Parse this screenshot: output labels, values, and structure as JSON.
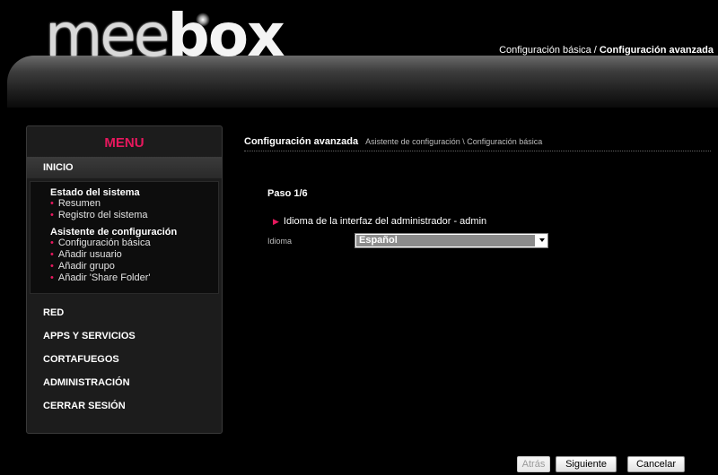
{
  "header": {
    "logo_light": "mee",
    "logo_bold": "box",
    "nav": {
      "basic": "Configuración básica",
      "separator": "/",
      "advanced": "Configuración avanzada"
    }
  },
  "sidebar": {
    "title": "MENU",
    "inicio": "INICIO",
    "groups": [
      {
        "label": "Estado del sistema",
        "links": [
          "Resumen",
          "Registro del sistema"
        ]
      },
      {
        "label": "Asistente de configuración",
        "links": [
          "Configuración básica",
          "Añadir usuario",
          "Añadir grupo",
          "Añadir 'Share Folder'"
        ]
      }
    ],
    "items": [
      "RED",
      "APPS Y SERVICIOS",
      "CORTAFUEGOS",
      "ADMINISTRACIÓN",
      "CERRAR SESIÓN"
    ]
  },
  "content": {
    "title": "Configuración avanzada",
    "breadcrumb": "Asistente de configuración \\ Configuración básica",
    "step": "Paso 1/6",
    "section": "Idioma de la interfaz del administrador - admin",
    "field_label": "Idioma",
    "select_value": "Español"
  },
  "buttons": {
    "back": "Atrás",
    "next": "Siguiente",
    "cancel": "Cancelar"
  },
  "colors": {
    "accent": "#e8185e",
    "background": "#000000"
  }
}
